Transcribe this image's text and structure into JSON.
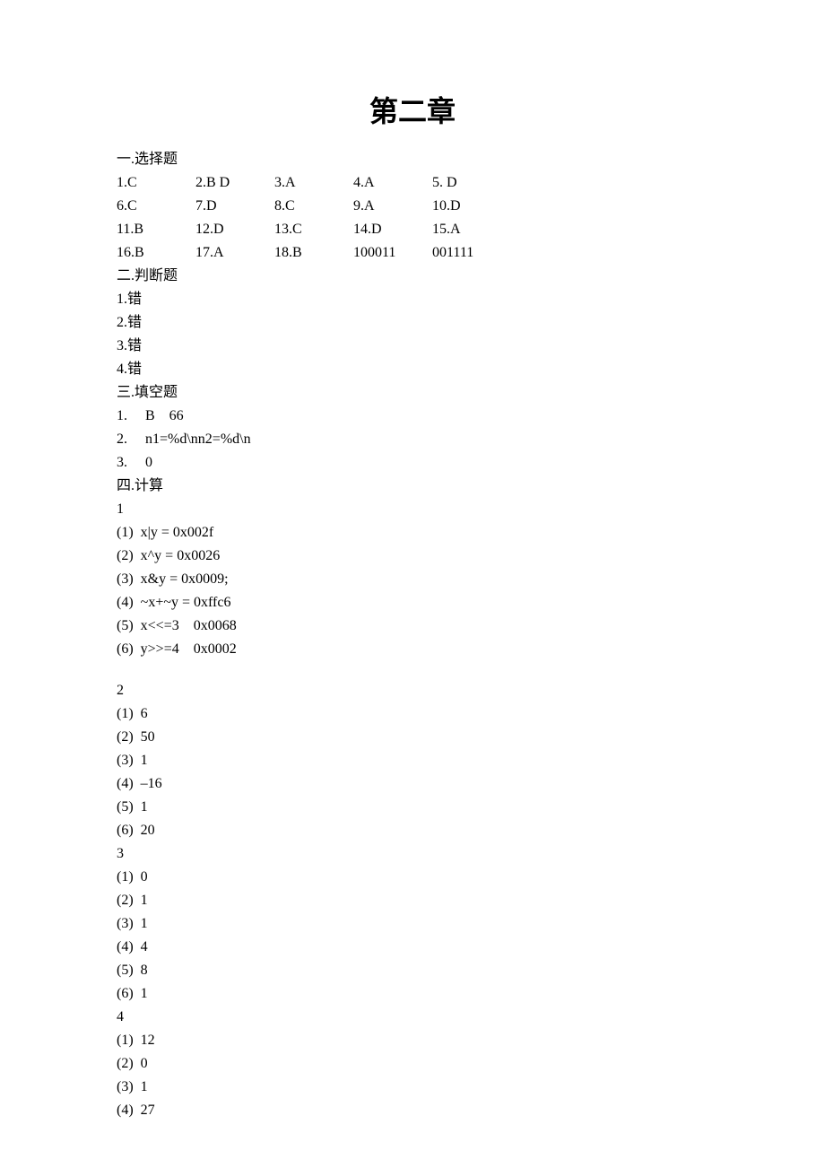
{
  "title": "第二章",
  "section1": {
    "heading": "一.选择题",
    "rows": [
      [
        "1.C",
        "2.B D",
        "3.A",
        "4.A",
        "5. D"
      ],
      [
        "6.C",
        "7.D",
        "8.C",
        "9.A",
        "10.D"
      ],
      [
        "11.B",
        "12.D",
        "13.C",
        "14.D",
        "15.A"
      ],
      [
        "16.B",
        "17.A",
        "18.B",
        "100011",
        "001111"
      ]
    ]
  },
  "section2": {
    "heading": "二.判断题",
    "items": [
      "1.错",
      "2.错",
      "3.错",
      "4.错"
    ]
  },
  "section3": {
    "heading": "三.填空题",
    "items": [
      "1.     B    66",
      "2.     n1=%d\\nn2=%d\\n",
      "3.     0"
    ]
  },
  "section4": {
    "heading": "四.计算",
    "groups": [
      {
        "num": "1",
        "items": [
          "(1)  x|y = 0x002f",
          "(2)  x^y = 0x0026",
          "(3)  x&y = 0x0009;",
          "(4)  ~x+~y = 0xffc6",
          "(5)  x<<=3    0x0068",
          "(6)  y>>=4    0x0002"
        ],
        "blank_after": true
      },
      {
        "num": "2",
        "items": [
          "(1)  6",
          "(2)  50",
          "(3)  1",
          "(4)  –16",
          "(5)  1",
          "(6)  20"
        ]
      },
      {
        "num": "3",
        "items": [
          "(1)  0",
          "(2)  1",
          "(3)  1",
          "(4)  4",
          "(5)  8",
          "(6)  1"
        ]
      },
      {
        "num": "4",
        "items": [
          "(1)  12",
          "(2)  0",
          "(3)  1",
          "(4)  27"
        ]
      }
    ]
  }
}
